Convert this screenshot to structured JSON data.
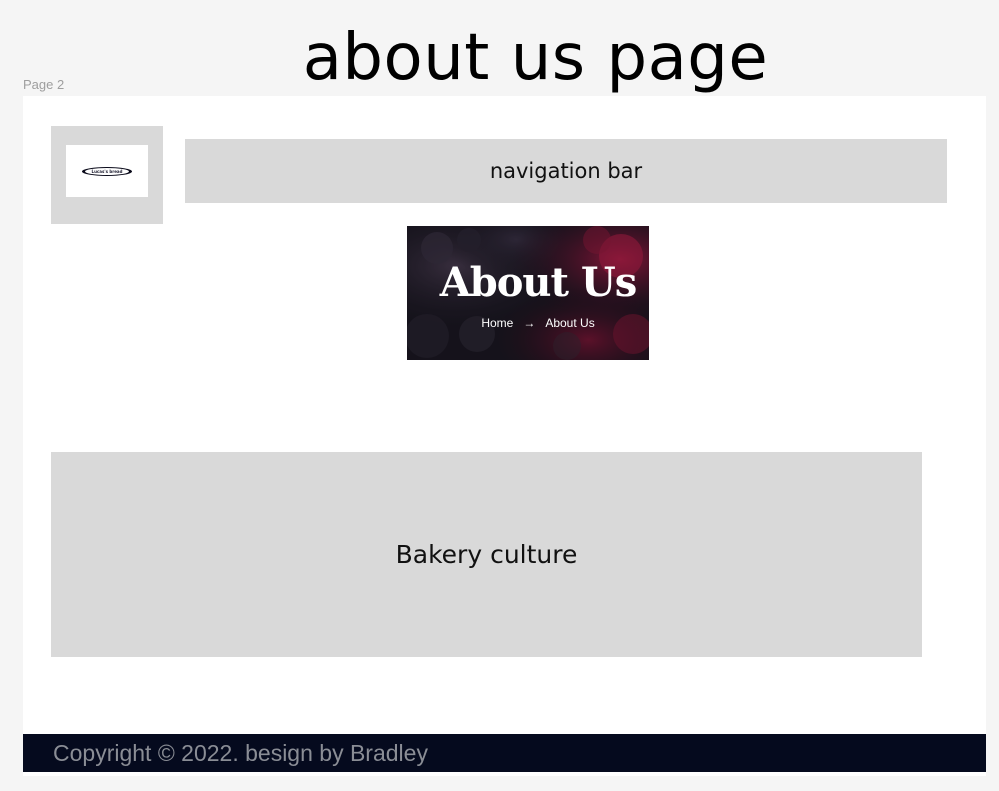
{
  "canvas": {
    "title": "about us page",
    "frame_label": "Page 2"
  },
  "logo": {
    "text": "Lucas's bread"
  },
  "nav": {
    "label": "navigation bar"
  },
  "hero": {
    "title": "About Us",
    "breadcrumb": {
      "home": "Home",
      "separator": "→",
      "current": "About Us"
    }
  },
  "culture": {
    "label": "Bakery culture"
  },
  "footer": {
    "copyright": "Copyright © 2022. besign by Bradley"
  },
  "colors": {
    "placeholder_gray": "#d9d9d9",
    "footer_bg": "#050a1e",
    "canvas_bg": "#f5f5f5",
    "frame_bg": "#ffffff"
  }
}
